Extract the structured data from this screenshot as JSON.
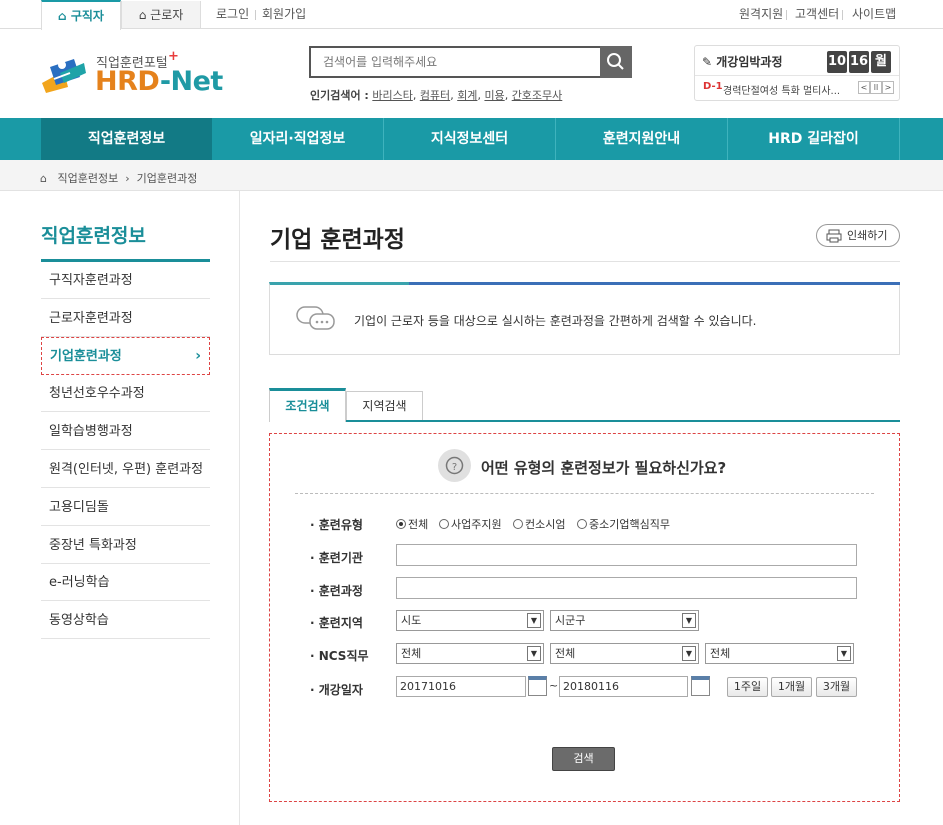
{
  "top": {
    "tab_jobseeker": "구직자",
    "tab_worker": "근로자",
    "login": "로그인",
    "signup": "회원가입",
    "remote_support": "원격지원",
    "customer_center": "고객센터",
    "sitemap": "사이트맵"
  },
  "logo": {
    "subtitle": "직업훈련포털",
    "plus": "+",
    "name_main": "HRD",
    "name_net": "-Net"
  },
  "search": {
    "placeholder": "검색어를 입력해주세요",
    "popular_label": "인기검색어 :",
    "keywords": [
      "바리스타",
      "컴퓨터",
      "회계",
      "미용",
      "간호조무사"
    ]
  },
  "widget": {
    "title": "개강임박과정",
    "date_month": "10",
    "date_day": "16",
    "date_weekday": "월",
    "dday": "D-1",
    "course": "경력단절여성 특화 멀티사...",
    "prev": "<",
    "pause": "ll",
    "next": ">"
  },
  "nav": {
    "items": [
      "직업훈련정보",
      "일자리·직업정보",
      "지식정보센터",
      "훈련지원안내",
      "HRD 길라잡이"
    ]
  },
  "breadcrumb": {
    "home_icon": "home-icon",
    "level1": "직업훈련정보",
    "level2": "기업훈련과정"
  },
  "sidebar": {
    "title": "직업훈련정보",
    "items": [
      "구직자훈련과정",
      "근로자훈련과정",
      "기업훈련과정",
      "청년선호우수과정",
      "일학습병행과정",
      "원격(인터넷, 우편) 훈련과정",
      "고용디딤돌",
      "중장년 특화과정",
      "e-러닝학습",
      "동영상학습"
    ],
    "active_index": 2
  },
  "content": {
    "title": "기업 훈련과정",
    "print_label": "인쇄하기",
    "info": "기업이 근로자 등을 대상으로 실시하는 훈련과정을 간편하게 검색할 수 있습니다.",
    "tab_condition": "조건검색",
    "tab_region": "지역검색"
  },
  "form": {
    "question": "어떤 유형의 훈련정보가 필요하신가요?",
    "label_type": "· 훈련유형",
    "label_org": "· 훈련기관",
    "label_course": "· 훈련과정",
    "label_region": "· 훈련지역",
    "label_ncs": "· NCS직무",
    "label_date": "· 개강일자",
    "radios": [
      "전체",
      "사업주지원",
      "컨소시엄",
      "중소기업핵심직무"
    ],
    "radio_selected": 0,
    "region_sido": "시도",
    "region_sigungu": "시군구",
    "ncs1": "전체",
    "ncs2": "전체",
    "ncs3": "전체",
    "date_from": "20171016",
    "date_tilde": "~",
    "date_to": "20180116",
    "btn_1w": "1주일",
    "btn_1m": "1개월",
    "btn_3m": "3개월",
    "submit": "검색"
  },
  "colors": {
    "teal": "#1a9aa6",
    "teal_dark": "#127a85",
    "orange": "#e5821c",
    "dashed_red": "#dd4444"
  }
}
